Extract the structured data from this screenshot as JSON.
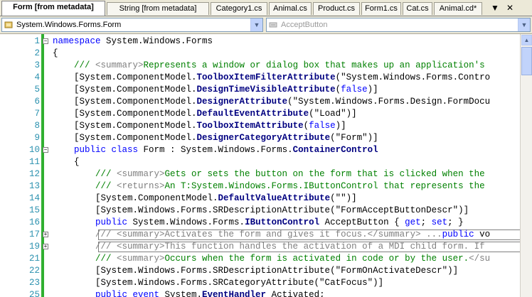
{
  "tabs": [
    {
      "label": "Form [from metadata]",
      "active": true
    },
    {
      "label": "String [from metadata]",
      "active": false
    },
    {
      "label": "Category1.cs",
      "active": false
    },
    {
      "label": "Animal.cs",
      "active": false
    },
    {
      "label": "Product.cs",
      "active": false
    },
    {
      "label": "Form1.cs",
      "active": false
    },
    {
      "label": "Cat.cs",
      "active": false
    },
    {
      "label": "Animal.cd*",
      "active": false
    }
  ],
  "tab_controls": {
    "dropdown": "▼",
    "close": "✕"
  },
  "nav": {
    "type_combo": "System.Windows.Forms.Form",
    "member_combo": "AcceptButton",
    "type_icon": "class-icon",
    "member_icon": "property-icon"
  },
  "colors": {
    "keyword": "#0000ff",
    "comment": "#008000",
    "xmldoc": "#808080",
    "type": "#000080",
    "line_number": "#2b91af",
    "modified_bar": "#30b030"
  },
  "lines": [
    {
      "n": "1",
      "fold": "−",
      "code": [
        {
          "t": "namespace",
          "c": "kw"
        },
        {
          "t": " System.Windows.Forms",
          "c": ""
        }
      ]
    },
    {
      "n": "2",
      "fold": "",
      "code": [
        {
          "t": "{",
          "c": ""
        }
      ]
    },
    {
      "n": "3",
      "fold": "",
      "code": [
        {
          "t": "    /// ",
          "c": "cm"
        },
        {
          "t": "<summary>",
          "c": "xd"
        },
        {
          "t": "Represents a window or dialog box that makes up an application's",
          "c": "cm"
        }
      ]
    },
    {
      "n": "4",
      "fold": "",
      "code": [
        {
          "t": "    [System.ComponentModel.",
          "c": ""
        },
        {
          "t": "ToolboxItemFilterAttribute",
          "c": "ty"
        },
        {
          "t": "(\"System.Windows.Forms.Contro",
          "c": ""
        }
      ]
    },
    {
      "n": "5",
      "fold": "",
      "code": [
        {
          "t": "    [System.ComponentModel.",
          "c": ""
        },
        {
          "t": "DesignTimeVisibleAttribute",
          "c": "ty"
        },
        {
          "t": "(",
          "c": ""
        },
        {
          "t": "false",
          "c": "kw"
        },
        {
          "t": ")]",
          "c": ""
        }
      ]
    },
    {
      "n": "6",
      "fold": "",
      "code": [
        {
          "t": "    [System.ComponentModel.",
          "c": ""
        },
        {
          "t": "DesignerAttribute",
          "c": "ty"
        },
        {
          "t": "(\"System.Windows.Forms.Design.FormDocu",
          "c": ""
        }
      ]
    },
    {
      "n": "7",
      "fold": "",
      "code": [
        {
          "t": "    [System.ComponentModel.",
          "c": ""
        },
        {
          "t": "DefaultEventAttribute",
          "c": "ty"
        },
        {
          "t": "(\"Load\")]",
          "c": ""
        }
      ]
    },
    {
      "n": "8",
      "fold": "",
      "code": [
        {
          "t": "    [System.ComponentModel.",
          "c": ""
        },
        {
          "t": "ToolboxItemAttribute",
          "c": "ty"
        },
        {
          "t": "(",
          "c": ""
        },
        {
          "t": "false",
          "c": "kw"
        },
        {
          "t": ")]",
          "c": ""
        }
      ]
    },
    {
      "n": "9",
      "fold": "",
      "code": [
        {
          "t": "    [System.ComponentModel.",
          "c": ""
        },
        {
          "t": "DesignerCategoryAttribute",
          "c": "ty"
        },
        {
          "t": "(\"Form\")]",
          "c": ""
        }
      ]
    },
    {
      "n": "10",
      "fold": "−",
      "code": [
        {
          "t": "    ",
          "c": ""
        },
        {
          "t": "public class",
          "c": "kw"
        },
        {
          "t": " Form : System.Windows.Forms.",
          "c": ""
        },
        {
          "t": "ContainerControl",
          "c": "ty"
        }
      ]
    },
    {
      "n": "11",
      "fold": "",
      "code": [
        {
          "t": "    {",
          "c": ""
        }
      ]
    },
    {
      "n": "12",
      "fold": "",
      "code": [
        {
          "t": "        /// ",
          "c": "cm"
        },
        {
          "t": "<summary>",
          "c": "xd"
        },
        {
          "t": "Gets or sets the button on the form that is clicked when the",
          "c": "cm"
        }
      ]
    },
    {
      "n": "13",
      "fold": "",
      "code": [
        {
          "t": "        /// ",
          "c": "cm"
        },
        {
          "t": "<returns>",
          "c": "xd"
        },
        {
          "t": "An T:System.Windows.Forms.IButtonControl that represents the",
          "c": "cm"
        }
      ]
    },
    {
      "n": "14",
      "fold": "",
      "code": [
        {
          "t": "        [System.ComponentModel.",
          "c": ""
        },
        {
          "t": "DefaultValueAttribute",
          "c": "ty"
        },
        {
          "t": "(\"\")]",
          "c": ""
        }
      ]
    },
    {
      "n": "15",
      "fold": "",
      "code": [
        {
          "t": "        [System.Windows.Forms.SRDescriptionAttribute(\"FormAcceptButtonDescr\")]",
          "c": ""
        }
      ]
    },
    {
      "n": "16",
      "fold": "",
      "code": [
        {
          "t": "        ",
          "c": ""
        },
        {
          "t": "public",
          "c": "kw"
        },
        {
          "t": " System.Windows.Forms.",
          "c": ""
        },
        {
          "t": "IButtonControl",
          "c": "ty"
        },
        {
          "t": " AcceptButton { ",
          "c": ""
        },
        {
          "t": "get",
          "c": "kw"
        },
        {
          "t": "; ",
          "c": ""
        },
        {
          "t": "set",
          "c": "kw"
        },
        {
          "t": "; }",
          "c": ""
        }
      ]
    },
    {
      "n": "17",
      "fold": "+",
      "boxed": true,
      "code": [
        {
          "t": "        /// ",
          "c": "xd"
        },
        {
          "t": "<summary>",
          "c": "xd"
        },
        {
          "t": "Activates the form and gives it focus.",
          "c": "xd"
        },
        {
          "t": "</summary>",
          "c": "xd"
        },
        {
          "t": " ...",
          "c": "xd"
        },
        {
          "t": "public",
          "c": "kw"
        },
        {
          "t": " vo",
          "c": ""
        }
      ]
    },
    {
      "n": "19",
      "fold": "+",
      "boxed": true,
      "code": [
        {
          "t": "        /// ",
          "c": "xd"
        },
        {
          "t": "<summary>",
          "c": "xd"
        },
        {
          "t": "This function handles the activation of a MDI child form. If",
          "c": "xd"
        }
      ]
    },
    {
      "n": "21",
      "fold": "",
      "code": [
        {
          "t": "        /// ",
          "c": "cm"
        },
        {
          "t": "<summary>",
          "c": "xd"
        },
        {
          "t": "Occurs when the form is activated in code or by the user.",
          "c": "cm"
        },
        {
          "t": "</su",
          "c": "xd"
        }
      ]
    },
    {
      "n": "22",
      "fold": "",
      "code": [
        {
          "t": "        [System.Windows.Forms.SRDescriptionAttribute(\"FormOnActivateDescr\")]",
          "c": ""
        }
      ]
    },
    {
      "n": "23",
      "fold": "",
      "code": [
        {
          "t": "        [System.Windows.Forms.SRCategoryAttribute(\"CatFocus\")]",
          "c": ""
        }
      ]
    },
    {
      "n": "25",
      "fold": "",
      "code": [
        {
          "t": "        ",
          "c": ""
        },
        {
          "t": "public event",
          "c": "kw"
        },
        {
          "t": " System.",
          "c": ""
        },
        {
          "t": "EventHandler",
          "c": "ty"
        },
        {
          "t": " Activated;",
          "c": ""
        }
      ]
    }
  ]
}
